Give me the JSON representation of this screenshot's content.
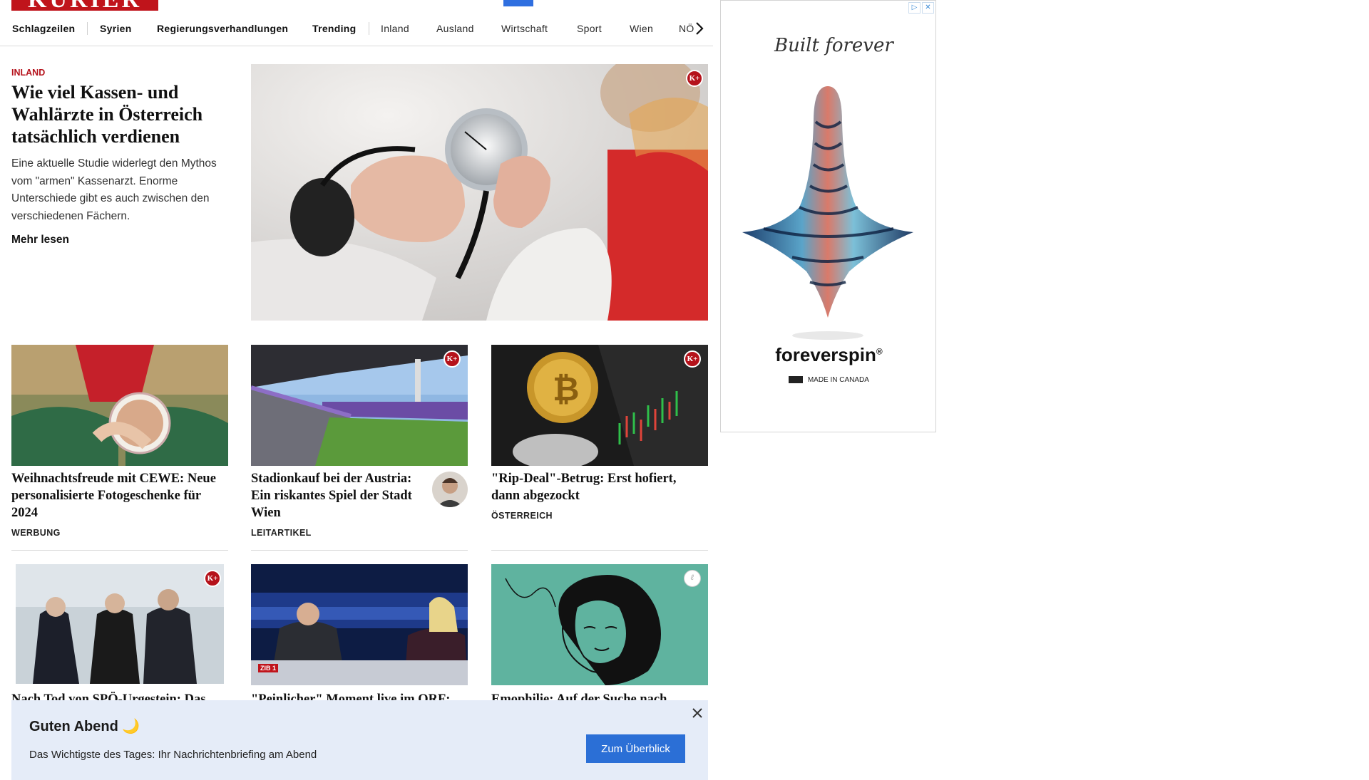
{
  "header": {
    "logo_text": "KURIER"
  },
  "nav": {
    "items": [
      {
        "label": "Schlagzeilen"
      },
      {
        "label": "Syrien"
      },
      {
        "label": "Regierungsverhandlungen"
      },
      {
        "label": "Trending"
      },
      {
        "label": "Inland"
      },
      {
        "label": "Ausland"
      },
      {
        "label": "Wirtschaft"
      },
      {
        "label": "Sport"
      },
      {
        "label": "Wien"
      },
      {
        "label": "NÖ"
      }
    ],
    "more_icon": "chevron-right-icon"
  },
  "lead": {
    "category": "INLAND",
    "title": "Wie viel Kassen- und Wahlärzte in Österreich tatsächlich verdienen",
    "teaser": "Eine aktuelle Studie widerlegt den Mythos vom \"armen\" Kassenarzt. Enorme Unterschiede gibt es auch zwischen den verschiedenen Fächern.",
    "more": "Mehr lesen",
    "premium_badge": "K+"
  },
  "cards": [
    {
      "title": "Weihnachtsfreude mit CEWE: Neue personalisierte Fotogeschenke für 2024",
      "tag": "WERBUNG"
    },
    {
      "title": "Stadionkauf bei der Aus­tria: Ein riskantes Spiel der Stadt Wien",
      "tag": "LEITARTIKEL",
      "premium_badge": "K+"
    },
    {
      "title": "\"Rip-Deal\"-Betrug: Erst hofiert, dann abgezockt",
      "tag": "ÖSTERREICH",
      "premium_badge": "K+"
    },
    {
      "title": "Nach Tod von SPÖ-Urgestein: Das",
      "premium_badge": "K+"
    },
    {
      "title": "\"Peinlicher\" Moment live im ORF:",
      "image_label": "ZIB 1"
    },
    {
      "title": "Emophilie: Auf der Suche nach"
    }
  ],
  "ad": {
    "script_text": "Built forever",
    "brand": "foreverspin",
    "made_in": "MADE IN CANADA",
    "controls": [
      "ad-info-icon",
      "close-icon"
    ]
  },
  "banner": {
    "title": "Guten Abend 🌙",
    "text": "Das Wichtigste des Tages: Ihr Nachrichtenbriefing am Abend",
    "button": "Zum Überblick"
  },
  "colors": {
    "brand_red": "#c0141b",
    "premium_red": "#b5121b",
    "button_blue": "#2b6fd6",
    "banner_bg": "#e5ecf8"
  }
}
